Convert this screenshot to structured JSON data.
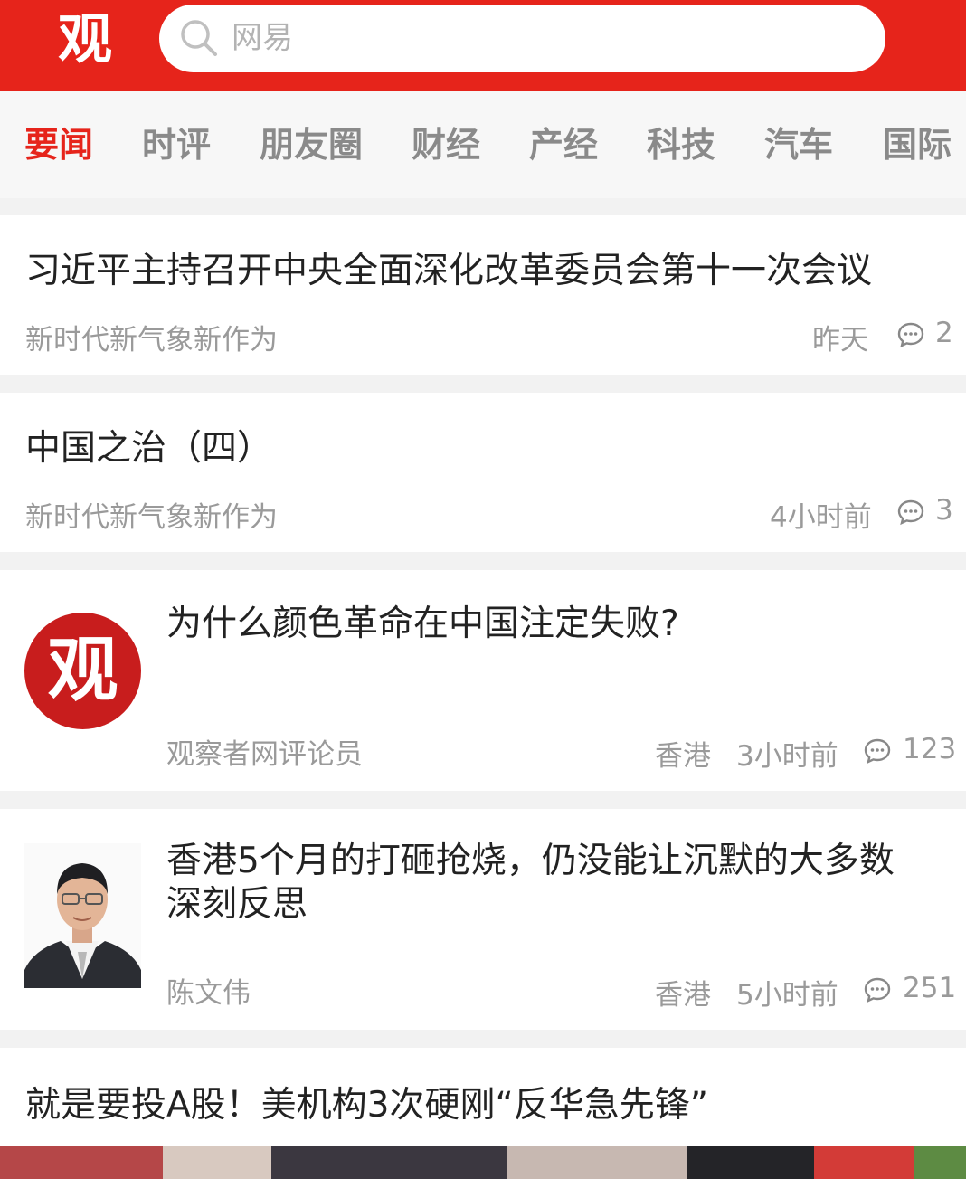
{
  "header": {
    "logo": "观",
    "search_placeholder": "网易"
  },
  "tabs": [
    "要闻",
    "时评",
    "朋友圈",
    "财经",
    "产经",
    "科技",
    "汽车",
    "国际"
  ],
  "active_tab": "要闻",
  "colors": {
    "brand_red": "#e6241b"
  },
  "news": [
    {
      "title": "习近平主持召开中央全面深化改革委员会第十一次会议",
      "source": "新时代新气象新作为",
      "time": "昨天",
      "comments": "2"
    },
    {
      "title": "中国之治（四）",
      "source": "新时代新气象新作为",
      "time": "4小时前",
      "comments": "3"
    },
    {
      "title": "为什么颜色革命在中国注定失败?",
      "author": "观察者网评论员",
      "location": "香港",
      "time": "3小时前",
      "comments": "123",
      "avatar_text": "观"
    },
    {
      "title_line1": "香港5个月的打砸抢烧，仍没能让沉默的大多数",
      "title_line2": "深刻反思",
      "author": "陈文伟",
      "location": "香港",
      "time": "5小时前",
      "comments": "251"
    },
    {
      "title": "就是要投A股！美机构3次硬刚“反华急先锋”"
    }
  ]
}
